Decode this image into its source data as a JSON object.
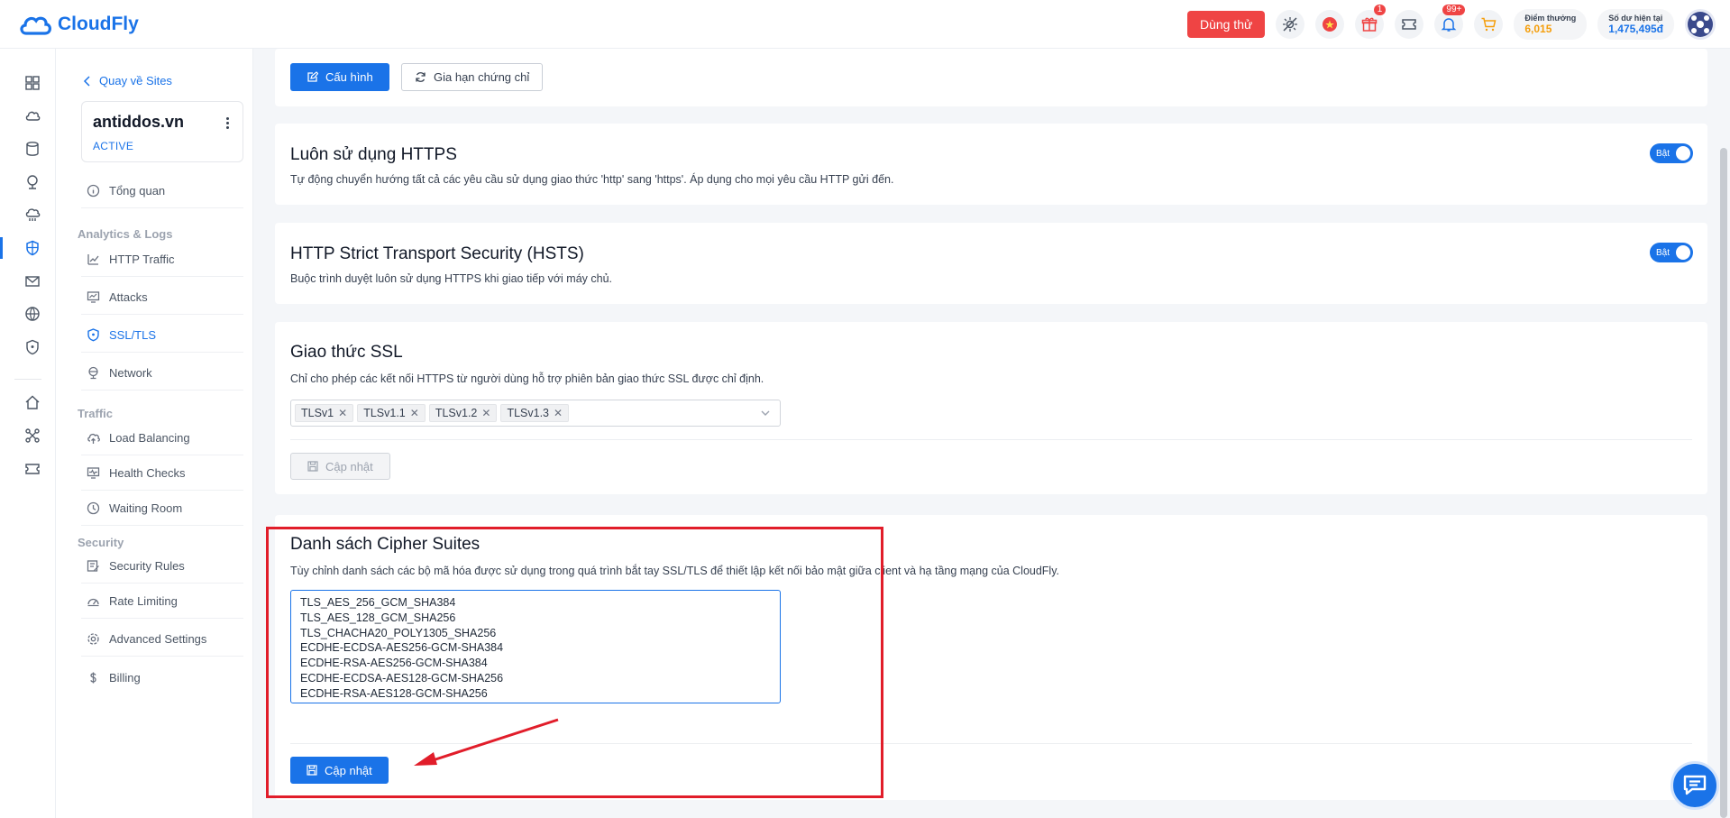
{
  "brand": {
    "name": "CloudFly",
    "color": "#1a73e8"
  },
  "header": {
    "trial_label": "Dùng thử",
    "gift_badge": "1",
    "notif_badge": "99+",
    "points": {
      "label": "Điểm thưởng",
      "value": "6,015",
      "color": "#f59e0b"
    },
    "balance": {
      "label": "Số dư hiện tại",
      "value": "1,475,495đ",
      "color": "#1a73e8"
    }
  },
  "sidebar": {
    "back_label": "Quay về Sites",
    "site": {
      "name": "antiddos.vn",
      "status": "ACTIVE"
    },
    "overview": "Tổng quan",
    "analytics_head": "Analytics & Logs",
    "analytics_items": [
      "HTTP Traffic",
      "Attacks",
      "SSL/TLS",
      "Network"
    ],
    "traffic_head": "Traffic",
    "traffic_items": [
      "Load Balancing",
      "Health Checks",
      "Waiting Room"
    ],
    "security_head": "Security",
    "security_items": [
      "Security Rules",
      "Rate Limiting",
      "Advanced Settings",
      "Billing"
    ]
  },
  "cert_card": {
    "config_label": "Cấu hình",
    "renew_label": "Gia hạn chứng chỉ"
  },
  "https_card": {
    "title": "Luôn sử dụng HTTPS",
    "desc": "Tự động chuyển hướng tất cả các yêu cầu sử dụng giao thức 'http' sang 'https'. Áp dụng cho mọi yêu cầu HTTP gửi đến.",
    "toggle_label": "Bật"
  },
  "hsts_card": {
    "title": "HTTP Strict Transport Security (HSTS)",
    "desc": "Buộc trình duyệt luôn sử dụng HTTPS khi giao tiếp với máy chủ.",
    "toggle_label": "Bật"
  },
  "ssl_card": {
    "title": "Giao thức SSL",
    "desc": "Chỉ cho phép các kết nối HTTPS từ người dùng hỗ trợ phiên bản giao thức SSL được chỉ định.",
    "tags": [
      "TLSv1",
      "TLSv1.1",
      "TLSv1.2",
      "TLSv1.3"
    ],
    "update_label": "Cập nhật"
  },
  "cipher_card": {
    "title": "Danh sách Cipher Suites",
    "desc": "Tùy chỉnh danh sách các bộ mã hóa được sử dụng trong quá trình bắt tay SSL/TLS để thiết lập kết nối bảo mật giữa client và hạ tầng mạng của CloudFly.",
    "ciphers": [
      "TLS_AES_256_GCM_SHA384",
      "TLS_AES_128_GCM_SHA256",
      "TLS_CHACHA20_POLY1305_SHA256",
      "ECDHE-ECDSA-AES256-GCM-SHA384",
      "ECDHE-RSA-AES256-GCM-SHA384",
      "ECDHE-ECDSA-AES128-GCM-SHA256",
      "ECDHE-RSA-AES128-GCM-SHA256"
    ],
    "update_label": "Cập nhật"
  },
  "annotation_color": "#e11d2a"
}
